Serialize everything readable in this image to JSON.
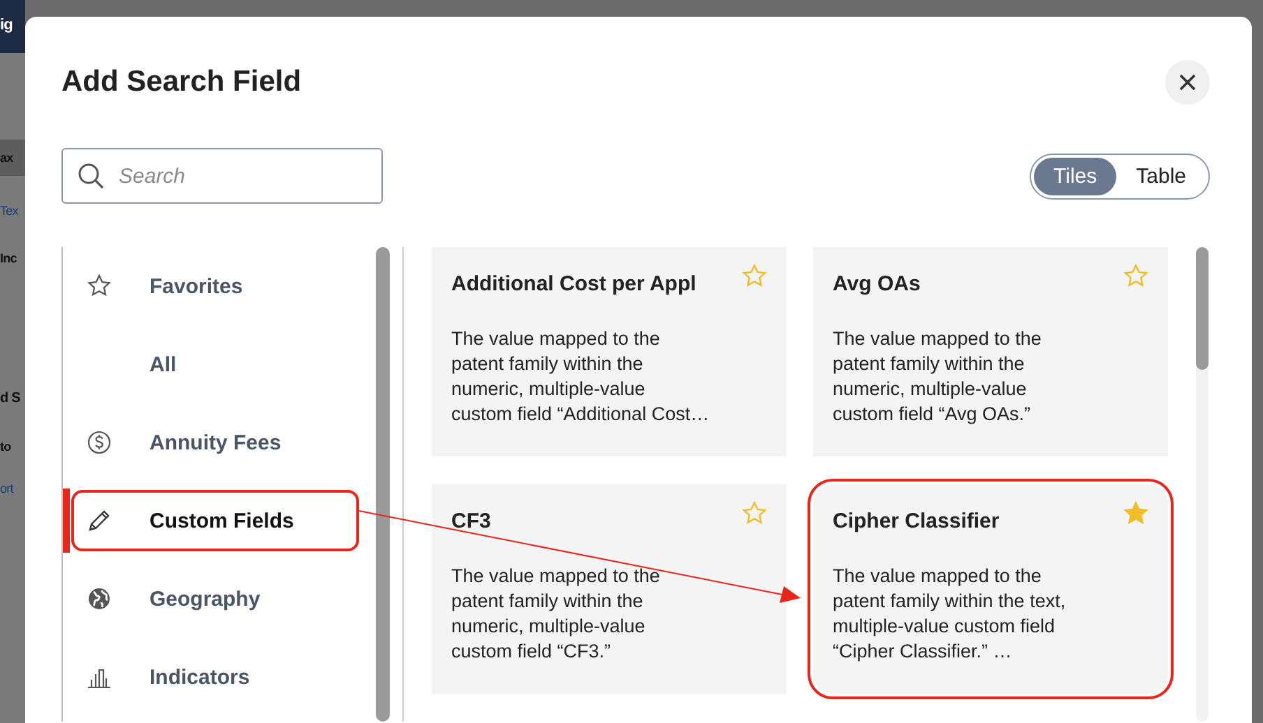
{
  "background_fragments": [
    {
      "text": "ig",
      "kind": "header"
    },
    {
      "text": "ax",
      "kind": "band"
    },
    {
      "text": "Tex",
      "kind": "link"
    },
    {
      "text": "Inc",
      "kind": "plain"
    },
    {
      "text": "d S",
      "kind": "heading"
    },
    {
      "text": "to",
      "kind": "plain"
    },
    {
      "text": "ort",
      "kind": "link"
    }
  ],
  "dialog": {
    "title": "Add Search Field",
    "search": {
      "placeholder": "Search"
    },
    "view_toggle": [
      {
        "label": "Tiles",
        "selected": true
      },
      {
        "label": "Table",
        "selected": false
      }
    ],
    "categories": [
      {
        "label": "Favorites",
        "kind": "star",
        "selected": false,
        "highlighted": false
      },
      {
        "label": "All",
        "kind": "plain",
        "selected": false,
        "highlighted": false
      },
      {
        "label": "Annuity Fees",
        "kind": "dollar",
        "selected": false,
        "highlighted": false
      },
      {
        "label": "Custom Fields",
        "kind": "pencil",
        "selected": true,
        "highlighted": true
      },
      {
        "label": "Geography",
        "kind": "globe",
        "selected": false,
        "highlighted": false
      },
      {
        "label": "Indicators",
        "kind": "chart",
        "selected": false,
        "highlighted": false
      }
    ],
    "tiles": [
      {
        "title": "Additional Cost per Appl",
        "description": "The value mapped to the patent family within the numeric, multiple-value custom field “Additional Cost…",
        "favorite": false,
        "highlighted": false
      },
      {
        "title": "Avg OAs",
        "description": "The value mapped to the patent family within the numeric, multiple-value custom field “Avg OAs.”",
        "favorite": false,
        "highlighted": false
      },
      {
        "title": "CF3",
        "description": "The value mapped to the patent family within the numeric, multiple-value custom field “CF3.”",
        "favorite": false,
        "highlighted": false
      },
      {
        "title": "Cipher Classifier",
        "description": "The value mapped to the patent family within the text, multiple-value custom field “Cipher Classifier.” …",
        "favorite": true,
        "highlighted": true
      }
    ],
    "callout_arrow": true
  }
}
